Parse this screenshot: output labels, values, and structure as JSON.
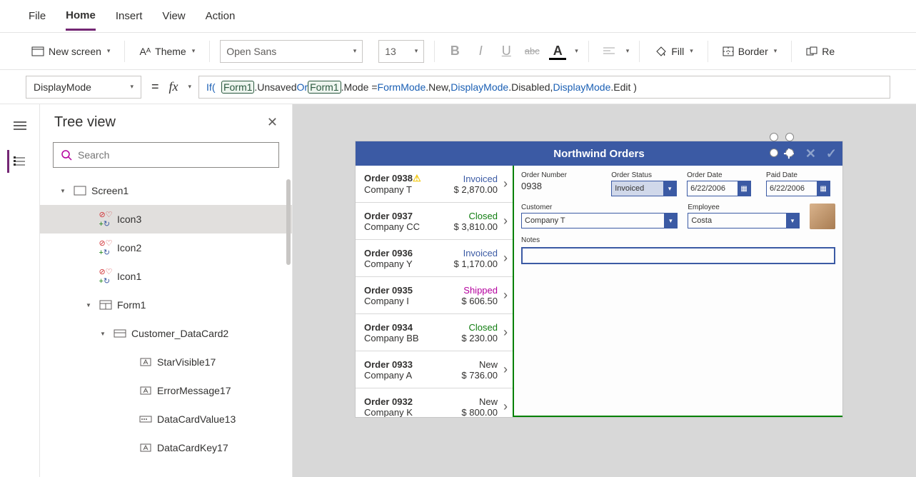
{
  "menu": {
    "file": "File",
    "home": "Home",
    "insert": "Insert",
    "view": "View",
    "action": "Action"
  },
  "toolbar": {
    "new_screen": "New screen",
    "theme": "Theme",
    "font_name": "Open Sans",
    "font_size": "13",
    "fill": "Fill",
    "border": "Border",
    "re": "Re"
  },
  "formula": {
    "property": "DisplayMode",
    "tokens": {
      "if": "If(",
      "form1a": "Form1",
      "unsaved": ".Unsaved",
      "or": " Or ",
      "form1b": "Form1",
      "mode": ".Mode = ",
      "formmode": "FormMode",
      "dotnew": ".New, ",
      "dm1": "DisplayMode",
      "disabled": ".Disabled, ",
      "dm2": "DisplayMode",
      "edit": ".Edit )"
    }
  },
  "tree": {
    "title": "Tree view",
    "search_placeholder": "Search",
    "items": [
      {
        "label": "Screen1",
        "depth": 1,
        "expand": "▾",
        "icon": "screen"
      },
      {
        "label": "Icon3",
        "depth": 2,
        "icon": "icongroup",
        "selected": true
      },
      {
        "label": "Icon2",
        "depth": 2,
        "icon": "icongroup"
      },
      {
        "label": "Icon1",
        "depth": 2,
        "icon": "icongroup"
      },
      {
        "label": "Form1",
        "depth": 2,
        "expand": "▾",
        "icon": "form"
      },
      {
        "label": "Customer_DataCard2",
        "depth": 3,
        "expand": "▾",
        "icon": "datacard"
      },
      {
        "label": "StarVisible17",
        "depth": 4,
        "icon": "label"
      },
      {
        "label": "ErrorMessage17",
        "depth": 4,
        "icon": "label"
      },
      {
        "label": "DataCardValue13",
        "depth": 4,
        "icon": "input"
      },
      {
        "label": "DataCardKey17",
        "depth": 4,
        "icon": "label"
      }
    ]
  },
  "app": {
    "title": "Northwind Orders",
    "orders": [
      {
        "order": "Order 0938",
        "company": "Company T",
        "status": "Invoiced",
        "status_class": "st-invoiced",
        "amount": "$ 2,870.00",
        "warn": true
      },
      {
        "order": "Order 0937",
        "company": "Company CC",
        "status": "Closed",
        "status_class": "st-closed",
        "amount": "$ 3,810.00"
      },
      {
        "order": "Order 0936",
        "company": "Company Y",
        "status": "Invoiced",
        "status_class": "st-invoiced",
        "amount": "$ 1,170.00"
      },
      {
        "order": "Order 0935",
        "company": "Company I",
        "status": "Shipped",
        "status_class": "st-shipped",
        "amount": "$ 606.50"
      },
      {
        "order": "Order 0934",
        "company": "Company BB",
        "status": "Closed",
        "status_class": "st-closed",
        "amount": "$ 230.00"
      },
      {
        "order": "Order 0933",
        "company": "Company A",
        "status": "New",
        "status_class": "st-new",
        "amount": "$ 736.00"
      },
      {
        "order": "Order 0932",
        "company": "Company K",
        "status": "New",
        "status_class": "st-new",
        "amount": "$ 800.00"
      }
    ],
    "form": {
      "order_number_label": "Order Number",
      "order_number": "0938",
      "order_status_label": "Order Status",
      "order_status": "Invoiced",
      "order_date_label": "Order Date",
      "order_date": "6/22/2006",
      "paid_date_label": "Paid Date",
      "paid_date": "6/22/2006",
      "customer_label": "Customer",
      "customer": "Company T",
      "employee_label": "Employee",
      "employee": "Costa",
      "notes_label": "Notes"
    }
  }
}
